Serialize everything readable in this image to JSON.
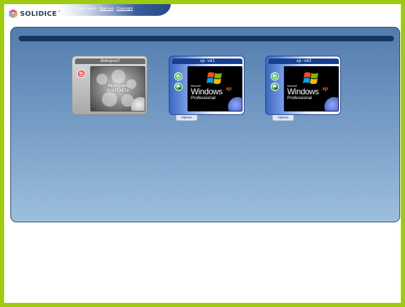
{
  "header": {
    "logo": {
      "brand_part1": "SOLID",
      "brand_part2": "ICE",
      "trademark": "™"
    },
    "user_label": "User: navin",
    "separator": " , ",
    "sign_out": "Sign out",
    "copyright": "Copyright"
  },
  "tiles": [
    {
      "name": "demopool",
      "type": "pool",
      "screen_line1": "Desktops",
      "screen_line2": "Available",
      "power_icon": "power-icon"
    },
    {
      "name": "xp-vm1",
      "type": "vm",
      "options_label": "Options",
      "os_microsoft": "Microsoft",
      "os_windows": "Windows",
      "os_xp": "xp",
      "os_edition": "Professional"
    },
    {
      "name": "xp-vm3",
      "type": "vm",
      "options_label": "Options",
      "os_microsoft": "Microsoft",
      "os_windows": "Windows",
      "os_xp": "xp",
      "os_edition": "Professional"
    }
  ],
  "colors": {
    "page_border": "#9ecb12",
    "panel_top": "#527cae",
    "panel_bottom": "#9dbfde",
    "panel_bar": "#15375f",
    "vm_title_bar": "#173f8f",
    "pool_title_bar": "#6b6b6b"
  }
}
